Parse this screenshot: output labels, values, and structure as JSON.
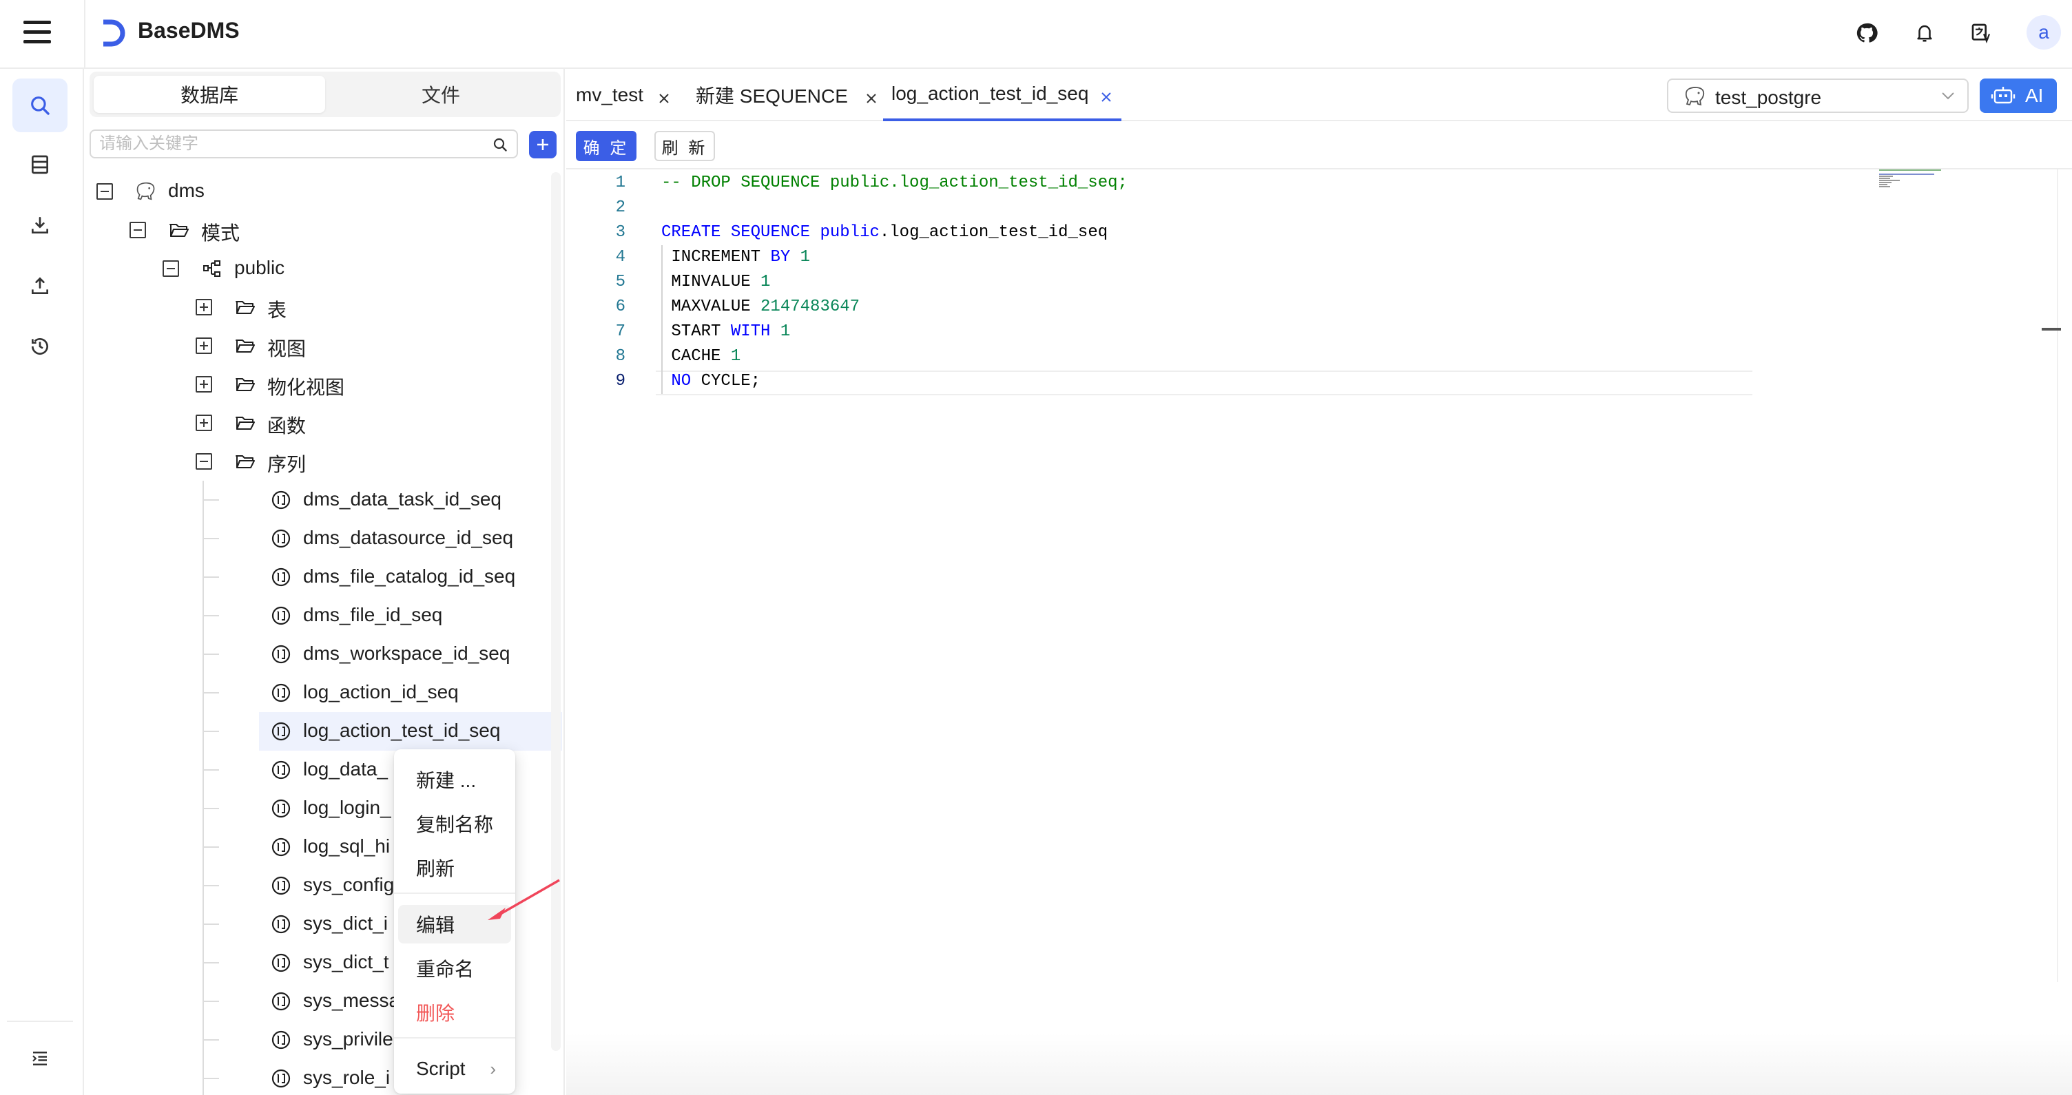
{
  "app": {
    "title": "BaseDMS"
  },
  "colors": {
    "accent": "#3b5ee6",
    "ai_button": "#3b78f0",
    "danger": "#f25757",
    "selected_row": "#eef2fd"
  },
  "header": {
    "icons": [
      "github-icon",
      "bell-icon",
      "translate-icon"
    ],
    "avatar_letter": "a"
  },
  "rail": {
    "items": [
      "search-icon",
      "document-list-icon",
      "download-icon",
      "upload-icon",
      "history-icon"
    ],
    "bottom": "collapse-menu-icon"
  },
  "explorer": {
    "tabs": [
      "数据库",
      "文件"
    ],
    "active_tab": "数据库",
    "search_placeholder": "请输入关键字",
    "tree": [
      {
        "label": "dms",
        "icon": "postgres-elephant-icon",
        "toggle": "expanded"
      },
      {
        "label": "模式",
        "icon": "folder-open-icon",
        "toggle": "expanded"
      },
      {
        "label": "public",
        "icon": "schema-icon",
        "toggle": "expanded"
      },
      {
        "label": "表",
        "icon": "folder-open-icon",
        "toggle": "collapsed"
      },
      {
        "label": "视图",
        "icon": "folder-open-icon",
        "toggle": "collapsed"
      },
      {
        "label": "物化视图",
        "icon": "folder-open-icon",
        "toggle": "collapsed"
      },
      {
        "label": "函数",
        "icon": "folder-open-icon",
        "toggle": "collapsed"
      },
      {
        "label": "序列",
        "icon": "folder-open-icon",
        "toggle": "expanded"
      },
      {
        "label": "dms_data_task_id_seq",
        "icon": "sequence-icon"
      },
      {
        "label": "dms_datasource_id_seq",
        "icon": "sequence-icon"
      },
      {
        "label": "dms_file_catalog_id_seq",
        "icon": "sequence-icon"
      },
      {
        "label": "dms_file_id_seq",
        "icon": "sequence-icon"
      },
      {
        "label": "dms_workspace_id_seq",
        "icon": "sequence-icon"
      },
      {
        "label": "log_action_id_seq",
        "icon": "sequence-icon"
      },
      {
        "label": "log_action_test_id_seq",
        "icon": "sequence-icon",
        "selected": true
      },
      {
        "label": "log_data_",
        "icon": "sequence-icon"
      },
      {
        "label": "log_login_",
        "icon": "sequence-icon"
      },
      {
        "label": "log_sql_hi",
        "icon": "sequence-icon"
      },
      {
        "label": "sys_config",
        "icon": "sequence-icon"
      },
      {
        "label": "sys_dict_i",
        "icon": "sequence-icon"
      },
      {
        "label": "sys_dict_t",
        "icon": "sequence-icon"
      },
      {
        "label": "sys_messa",
        "icon": "sequence-icon"
      },
      {
        "label": "sys_privile",
        "icon": "sequence-icon"
      },
      {
        "label": "sys_role_i",
        "icon": "sequence-icon"
      }
    ]
  },
  "context_menu": {
    "items": [
      {
        "label": "新建 ..."
      },
      {
        "label": "复制名称"
      },
      {
        "label": "刷新"
      },
      {
        "label": "编辑",
        "hover": true
      },
      {
        "label": "重命名"
      },
      {
        "label": "删除",
        "danger": true
      },
      {
        "label": "Script",
        "submenu": true
      }
    ]
  },
  "tabs": [
    {
      "label": "mv_test"
    },
    {
      "label": "新建 SEQUENCE"
    },
    {
      "label": "log_action_test_id_seq",
      "active": true
    }
  ],
  "connection": {
    "selected": "test_postgre",
    "icon": "postgres-elephant-icon"
  },
  "ai_button": {
    "label": "AI",
    "icon": "robot-icon"
  },
  "toolbar": {
    "confirm": "确 定",
    "refresh": "刷 新"
  },
  "editor": {
    "active_line": 9,
    "lines": [
      "-- DROP SEQUENCE public.log_action_test_id_seq;",
      "",
      "CREATE SEQUENCE public.log_action_test_id_seq",
      " INCREMENT BY 1",
      " MINVALUE 1",
      " MAXVALUE 2147483647",
      " START WITH 1",
      " CACHE 1",
      " NO CYCLE;"
    ]
  }
}
